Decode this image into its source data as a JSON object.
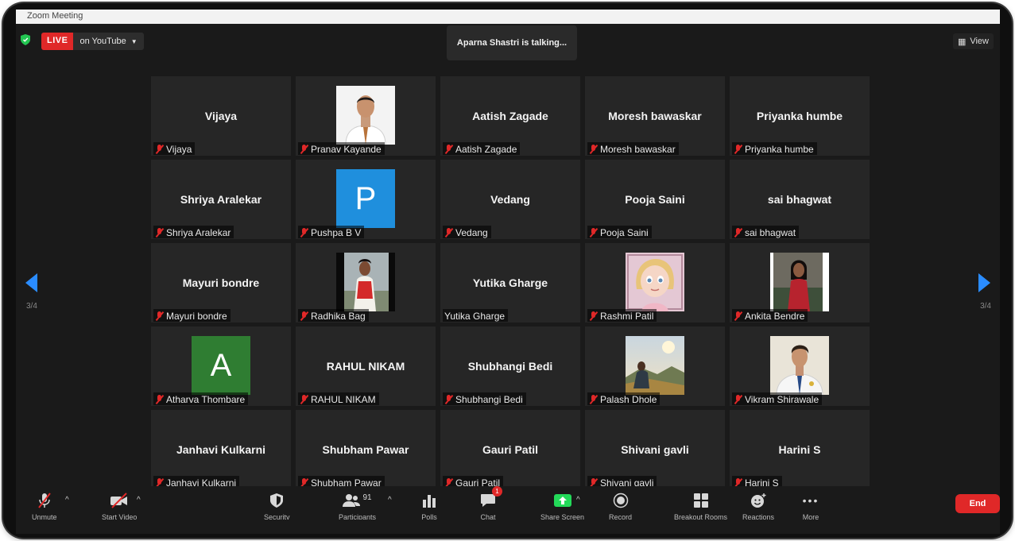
{
  "window": {
    "title": "Zoom Meeting"
  },
  "live": {
    "badge": "LIVE",
    "platform": "on YouTube"
  },
  "talking_indicator": "Aparna Shastri is talking...",
  "view_button": "View",
  "page_indicator": {
    "left": "3/4",
    "right": "3/4"
  },
  "participants": [
    {
      "name": "Vijaya",
      "display": "name"
    },
    {
      "name": "Pranav Kayande",
      "display": "photo"
    },
    {
      "name": "Aatish Zagade",
      "display": "name"
    },
    {
      "name": "Moresh bawaskar",
      "display": "name"
    },
    {
      "name": "Priyanka humbe",
      "display": "name"
    },
    {
      "name": "Shriya Aralekar",
      "display": "name"
    },
    {
      "name": "Pushpa B V",
      "display": "letter",
      "letter": "P",
      "color": "#1f8fdd"
    },
    {
      "name": "Vedang",
      "display": "name"
    },
    {
      "name": "Pooja Saini",
      "display": "name"
    },
    {
      "name": "sai bhagwat",
      "display": "name"
    },
    {
      "name": "Mayuri bondre",
      "display": "name"
    },
    {
      "name": "Radhika Bag",
      "display": "photo"
    },
    {
      "name": "Yutika Gharge",
      "display": "name",
      "muted": false
    },
    {
      "name": "Rashmi Patil",
      "display": "photo"
    },
    {
      "name": "Ankita Bendre",
      "display": "photo"
    },
    {
      "name": "Atharva Thombare",
      "display": "letter",
      "letter": "A",
      "color": "#2f7d32"
    },
    {
      "name": "RAHUL NIKAM",
      "display": "name"
    },
    {
      "name": "Shubhangi Bedi",
      "display": "name"
    },
    {
      "name": "Palash Dhole",
      "display": "photo"
    },
    {
      "name": "Vikram Shirawale",
      "display": "photo"
    },
    {
      "name": "Janhavi Kulkarni",
      "display": "name"
    },
    {
      "name": "Shubham Pawar",
      "display": "name"
    },
    {
      "name": "Gauri Patil",
      "display": "name"
    },
    {
      "name": "Shivani gavli",
      "display": "name"
    },
    {
      "name": "Harini S",
      "display": "name"
    }
  ],
  "toolbar": {
    "participants_count": "91",
    "chat_badge": "1",
    "end_label": "End",
    "labels": {
      "unmute": "Unmute",
      "start_video": "Start Video",
      "security": "Security",
      "participants": "Participants",
      "polls": "Polls",
      "chat": "Chat",
      "share_screen": "Share Screen",
      "record": "Record",
      "breakout": "Breakout Rooms",
      "reactions": "Reactions",
      "more": "More"
    }
  },
  "colors": {
    "live_red": "#e02828",
    "accent_blue": "#2a8cff",
    "share_green": "#23d959"
  }
}
